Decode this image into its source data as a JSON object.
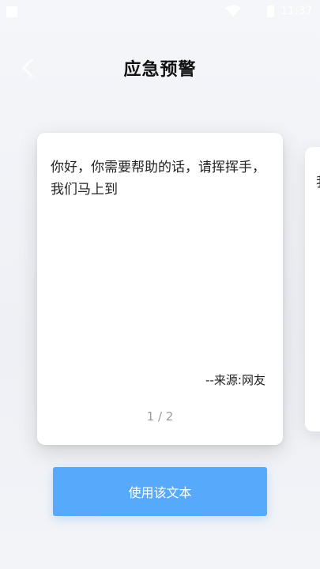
{
  "status_bar": {
    "time": "11:37",
    "icons": [
      "notification-icon",
      "wifi-icon",
      "battery-icon"
    ]
  },
  "header": {
    "title": "应急预警",
    "back_icon": "chevron-left-icon"
  },
  "card": {
    "text": "你好，你需要帮助的话，请挥挥手，我们马上到",
    "source": "--来源:网友",
    "pager": "1 / 2"
  },
  "next_card": {
    "glyph": "我"
  },
  "actions": {
    "use_text_label": "使用该文本"
  },
  "colors": {
    "primary": "#56a9fb",
    "background": "#f4f5f9",
    "card": "#ffffff",
    "pager_text": "#999999"
  }
}
